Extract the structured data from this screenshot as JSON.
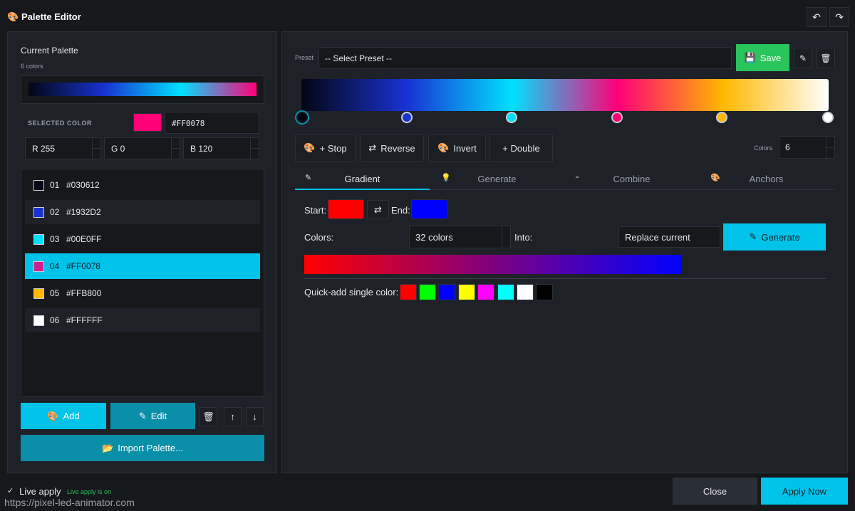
{
  "window": {
    "title": "Palette Editor"
  },
  "left": {
    "heading": "Current Palette",
    "count": "6 colors",
    "palette_colors": [
      "#030612",
      "#1932D2",
      "#00E0FF",
      "#FF0078",
      "#FFB800",
      "#FFFFFF"
    ],
    "selected_label": "SELECTED COLOR",
    "selected_hex": "#FF0078",
    "r": "R 255",
    "g": "G 0",
    "b": "B 120",
    "items": [
      {
        "index": "01",
        "hex": "#030612",
        "color": "#030612"
      },
      {
        "index": "02",
        "hex": "#1932D2",
        "color": "#1932D2"
      },
      {
        "index": "03",
        "hex": "#00E0FF",
        "color": "#00E0FF"
      },
      {
        "index": "04",
        "hex": "#FF0078",
        "color": "#d21e8c"
      },
      {
        "index": "05",
        "hex": "#FFB800",
        "color": "#FFB800"
      },
      {
        "index": "06",
        "hex": "#FFFFFF",
        "color": "#FFFFFF"
      }
    ],
    "add_label": "Add",
    "edit_label": "Edit",
    "import_label": "Import Palette..."
  },
  "right": {
    "preset_label": "Preset",
    "preset_value": "-- Select Preset --",
    "save_label": "Save",
    "actions": {
      "stop": "+ Stop",
      "reverse": "Reverse",
      "invert": "Invert",
      "double": "+ Double"
    },
    "colors_label": "Colors",
    "colors_value": "6",
    "tabs": [
      "Gradient",
      "Generate",
      "Combine",
      "Anchors"
    ],
    "start_label": "Start:",
    "end_label": "End:",
    "start_color": "#FF0000",
    "end_color": "#0000FF",
    "colors_row_label": "Colors:",
    "colors_select": "32 colors",
    "into_label": "Into:",
    "into_select": "Replace current",
    "generate_label": "Generate",
    "quick_label": "Quick-add single color:",
    "quick_colors": [
      "#FF0000",
      "#00FF00",
      "#0000FF",
      "#FFFF00",
      "#FF00FF",
      "#00FFFF",
      "#FFFFFF",
      "#000000"
    ]
  },
  "footer": {
    "live_apply": "Live apply",
    "live_status": "Live apply is on",
    "url": "https://pixel-led-animator.com",
    "close_label": "Close",
    "apply_label": "Apply Now"
  },
  "accent": "#00C3EA",
  "success": "#29C45B"
}
